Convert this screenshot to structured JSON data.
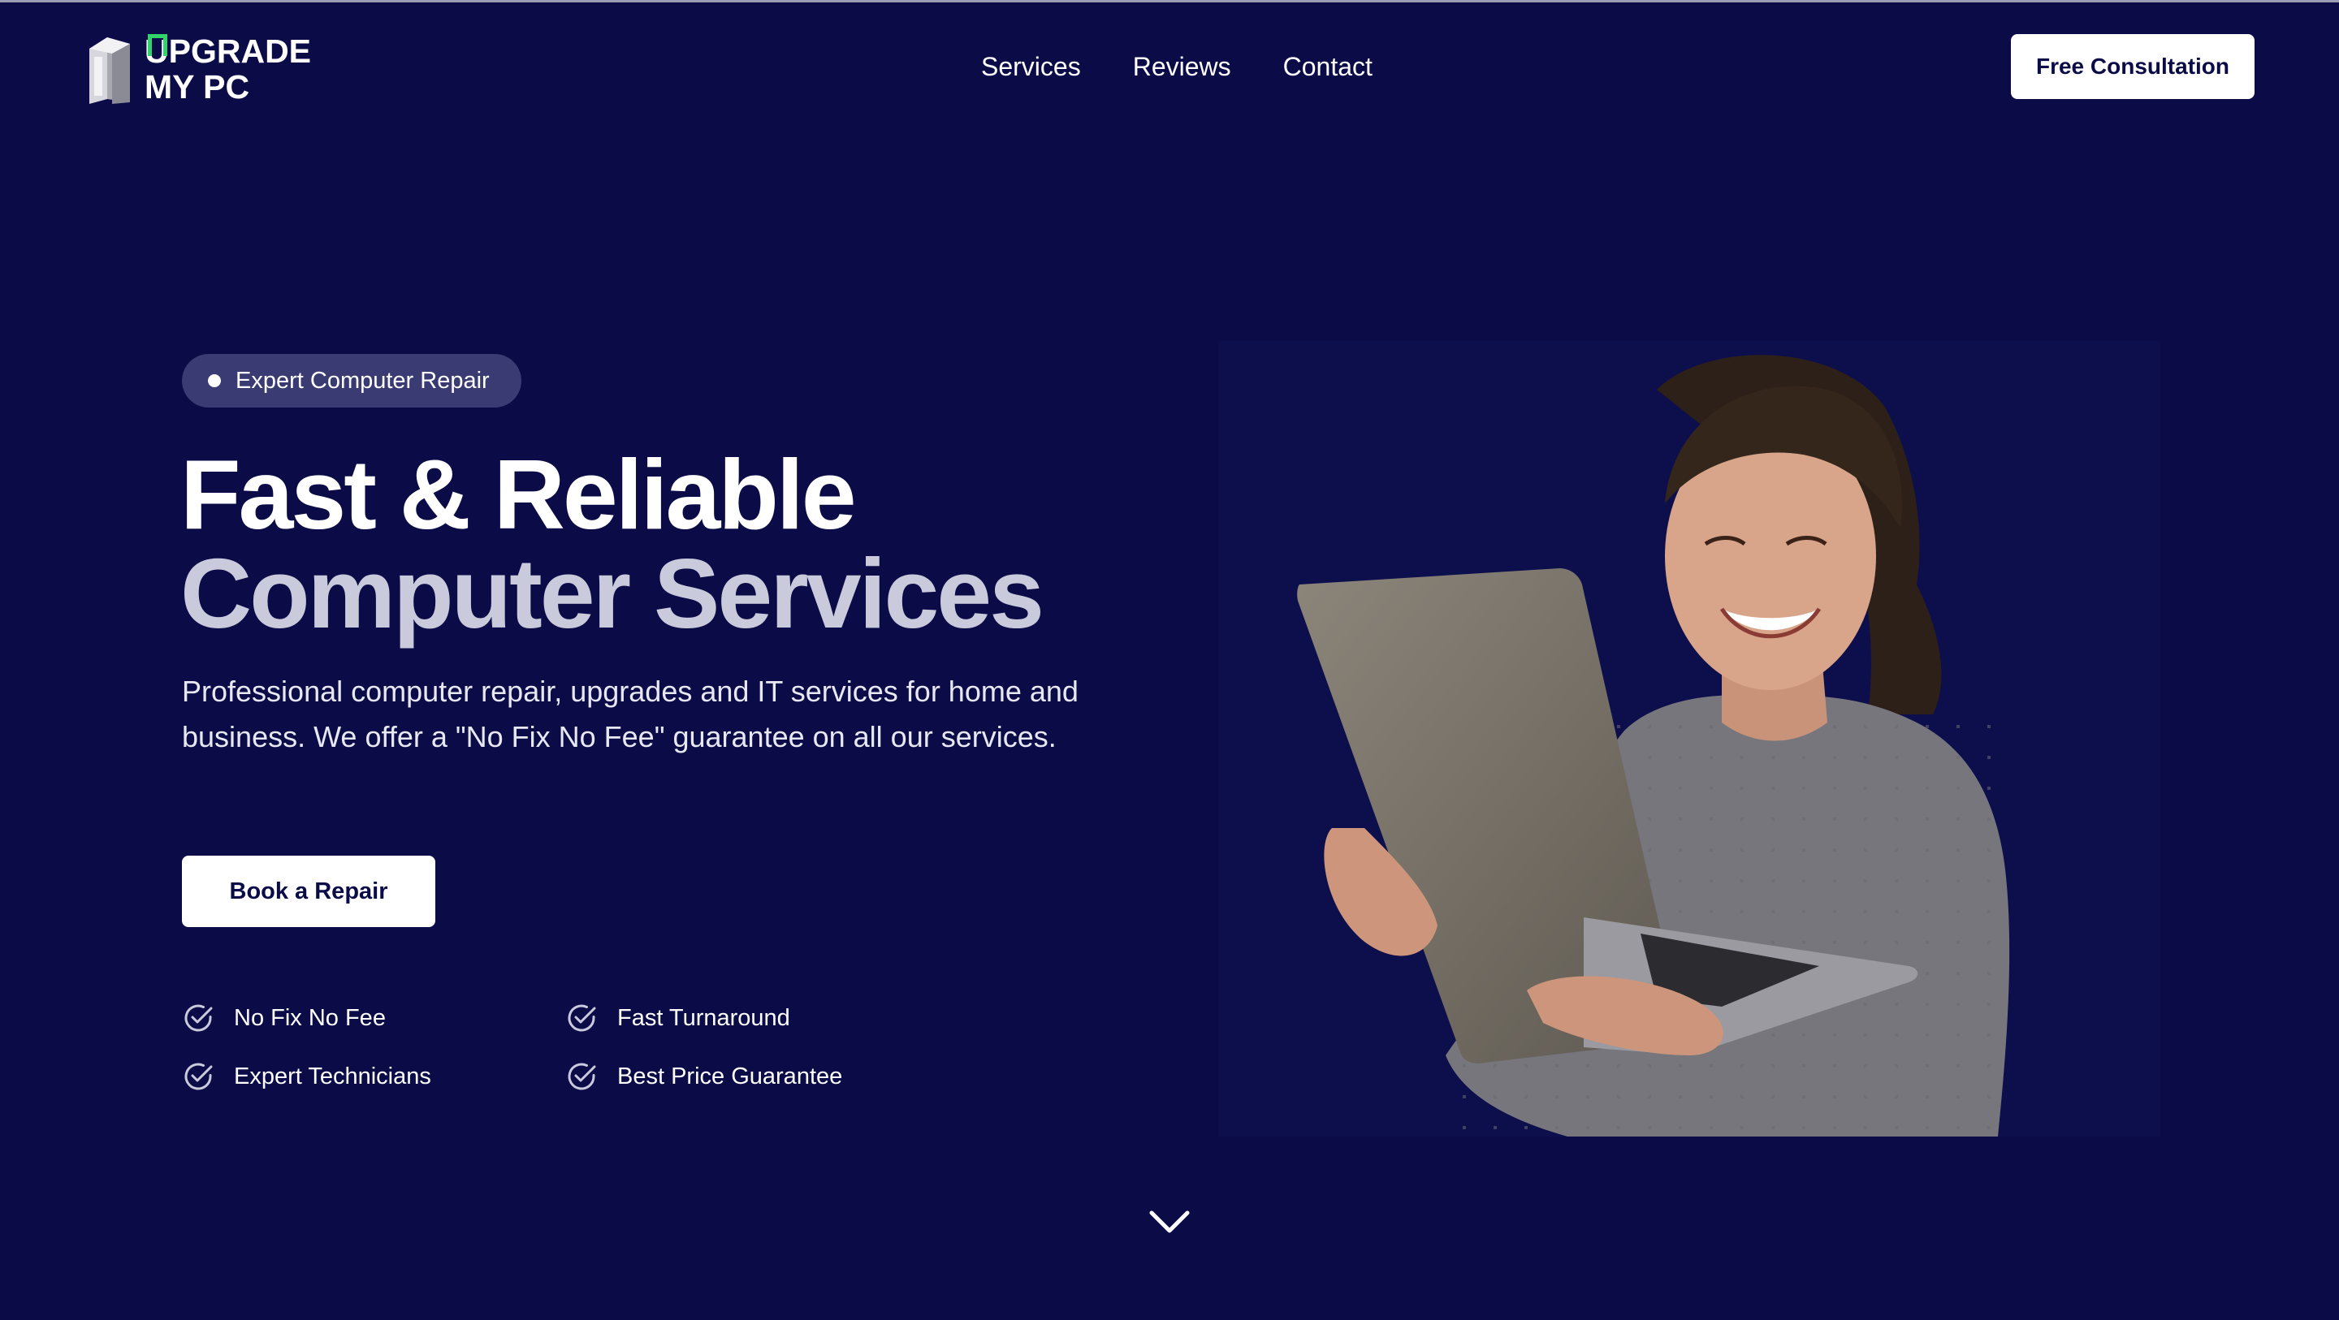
{
  "brand": {
    "line1": "UPGRADE",
    "line1_rest": "PGRADE",
    "line1_first": "U",
    "line2": "MY PC",
    "accent": "#32d36a"
  },
  "nav": {
    "items": [
      "Services",
      "Reviews",
      "Contact"
    ]
  },
  "header": {
    "cta": "Free Consultation"
  },
  "hero": {
    "badge": "Expert Computer Repair",
    "title_line1": "Fast & Reliable",
    "title_line2": "Computer Services",
    "lead": "Professional computer repair, upgrades and IT services for home and business. We offer a \"No Fix No Fee\" guarantee on all our services.",
    "cta": "Book a Repair",
    "features": [
      "No Fix No Fee",
      "Fast Turnaround",
      "Expert Technicians",
      "Best Price Guarantee"
    ]
  },
  "colors": {
    "background": "#0b0c47",
    "badge_bg": "#3a3b73",
    "title_secondary": "#c9cadb"
  },
  "icons": {
    "feature": "check-circle-icon",
    "scroll": "chevron-down-icon"
  }
}
